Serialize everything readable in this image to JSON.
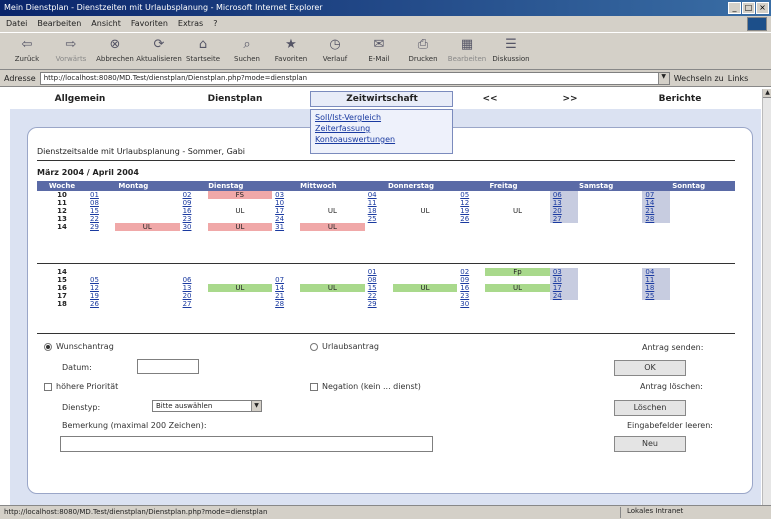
{
  "window": {
    "title": "Mein Dienstplan - Dienstzeiten mit Urlaubsplanung - Microsoft Internet Explorer"
  },
  "menu": [
    "Datei",
    "Bearbeiten",
    "Ansicht",
    "Favoriten",
    "Extras",
    "?"
  ],
  "toolbar": [
    {
      "label": "Zurück",
      "icon": "back-icon"
    },
    {
      "label": "Vorwärts",
      "icon": "forward-icon"
    },
    {
      "label": "Abbrechen",
      "icon": "stop-icon"
    },
    {
      "label": "Aktualisieren",
      "icon": "refresh-icon"
    },
    {
      "label": "Startseite",
      "icon": "home-icon"
    },
    {
      "label": "Suchen",
      "icon": "search-icon"
    },
    {
      "label": "Favoriten",
      "icon": "favorites-icon"
    },
    {
      "label": "Verlauf",
      "icon": "history-icon"
    },
    {
      "label": "E-Mail",
      "icon": "mail-icon"
    },
    {
      "label": "Drucken",
      "icon": "print-icon"
    },
    {
      "label": "Bearbeiten",
      "icon": "edit-icon"
    },
    {
      "label": "Diskussion",
      "icon": "discuss-icon"
    }
  ],
  "address": {
    "label": "Adresse",
    "value": "http://localhost:8080/MD.Test/dienstplan/Dienstplan.php?mode=dienstplan",
    "go": "Wechseln zu",
    "links": "Links"
  },
  "nav": {
    "items": [
      "Allgemein",
      "Dienstplan",
      "Zeitwirtschaft",
      "<<",
      ">>",
      "Berichte"
    ],
    "active": "Zeitwirtschaft"
  },
  "submenu": [
    "Soll/Ist-Vergleich",
    "Zeiterfassung",
    "Kontoauswertungen"
  ],
  "page": {
    "title": "Dienstzeitsalde mit Urlaubsplanung - Sommer, Gabi",
    "months": "März 2004 / April 2004"
  },
  "calendar": {
    "headers": [
      "Woche",
      "Montag",
      "Dienstag",
      "Mittwoch",
      "Donnerstag",
      "Freitag",
      "Samstag",
      "Sonntag"
    ],
    "march": [
      {
        "wk": "10",
        "days": [
          [
            "01",
            ""
          ],
          [
            "02",
            "FS"
          ],
          [
            "03",
            ""
          ],
          [
            "04",
            ""
          ],
          [
            "05",
            ""
          ],
          [
            "06",
            ""
          ],
          [
            "07",
            ""
          ]
        ]
      },
      {
        "wk": "11",
        "days": [
          [
            "08",
            ""
          ],
          [
            "09",
            ""
          ],
          [
            "10",
            ""
          ],
          [
            "11",
            ""
          ],
          [
            "12",
            ""
          ],
          [
            "13",
            ""
          ],
          [
            "14",
            ""
          ]
        ]
      },
      {
        "wk": "12",
        "days": [
          [
            "15",
            ""
          ],
          [
            "16",
            "UL"
          ],
          [
            "17",
            "UL"
          ],
          [
            "18",
            "UL"
          ],
          [
            "19",
            "UL"
          ],
          [
            "20",
            ""
          ],
          [
            "21",
            ""
          ]
        ]
      },
      {
        "wk": "13",
        "days": [
          [
            "22",
            ""
          ],
          [
            "23",
            ""
          ],
          [
            "24",
            ""
          ],
          [
            "25",
            ""
          ],
          [
            "26",
            ""
          ],
          [
            "27",
            ""
          ],
          [
            "28",
            ""
          ]
        ]
      },
      {
        "wk": "14",
        "days": [
          [
            "29",
            "UL"
          ],
          [
            "30",
            "UL"
          ],
          [
            "31",
            "UL"
          ],
          [
            "",
            ""
          ],
          [
            "",
            ""
          ],
          [
            "",
            ""
          ],
          [
            "",
            ""
          ]
        ]
      }
    ],
    "april": [
      {
        "wk": "14",
        "days": [
          [
            "",
            ""
          ],
          [
            "",
            ""
          ],
          [
            "",
            ""
          ],
          [
            "01",
            ""
          ],
          [
            "02",
            "Fp"
          ],
          [
            "03",
            ""
          ],
          [
            "04",
            ""
          ]
        ]
      },
      {
        "wk": "15",
        "days": [
          [
            "05",
            ""
          ],
          [
            "06",
            ""
          ],
          [
            "07",
            ""
          ],
          [
            "08",
            ""
          ],
          [
            "09",
            ""
          ],
          [
            "10",
            ""
          ],
          [
            "11",
            ""
          ]
        ]
      },
      {
        "wk": "16",
        "days": [
          [
            "12",
            ""
          ],
          [
            "13",
            "UL"
          ],
          [
            "14",
            "UL"
          ],
          [
            "15",
            "UL"
          ],
          [
            "16",
            "UL"
          ],
          [
            "17",
            ""
          ],
          [
            "18",
            ""
          ]
        ]
      },
      {
        "wk": "17",
        "days": [
          [
            "19",
            ""
          ],
          [
            "20",
            ""
          ],
          [
            "21",
            ""
          ],
          [
            "22",
            ""
          ],
          [
            "23",
            ""
          ],
          [
            "24",
            ""
          ],
          [
            "25",
            ""
          ]
        ]
      },
      {
        "wk": "18",
        "days": [
          [
            "26",
            ""
          ],
          [
            "27",
            ""
          ],
          [
            "28",
            ""
          ],
          [
            "29",
            ""
          ],
          [
            "30",
            ""
          ],
          [
            "",
            ""
          ],
          [
            "",
            ""
          ]
        ]
      }
    ]
  },
  "form": {
    "wish": "Wunschantrag",
    "vacation": "Urlaubsantrag",
    "date_label": "Datum:",
    "priority": "höhere Priorität",
    "neg": "Negation (kein ... dienst)",
    "service_label": "Dienstyp:",
    "service_value": "Bitte auswählen",
    "remark_label": "Bemerkung (maximal 200 Zeichen):",
    "send_label": "Antrag senden:",
    "send_btn": "OK",
    "delete_label": "Antrag löschen:",
    "delete_btn": "Löschen",
    "reset_label": "Eingabefelder leeren:",
    "reset_btn": "Neu"
  },
  "status": {
    "text": "http://localhost:8080/MD.Test/dienstplan/Dienstplan.php?mode=dienstplan",
    "zone": "Lokales Intranet"
  }
}
